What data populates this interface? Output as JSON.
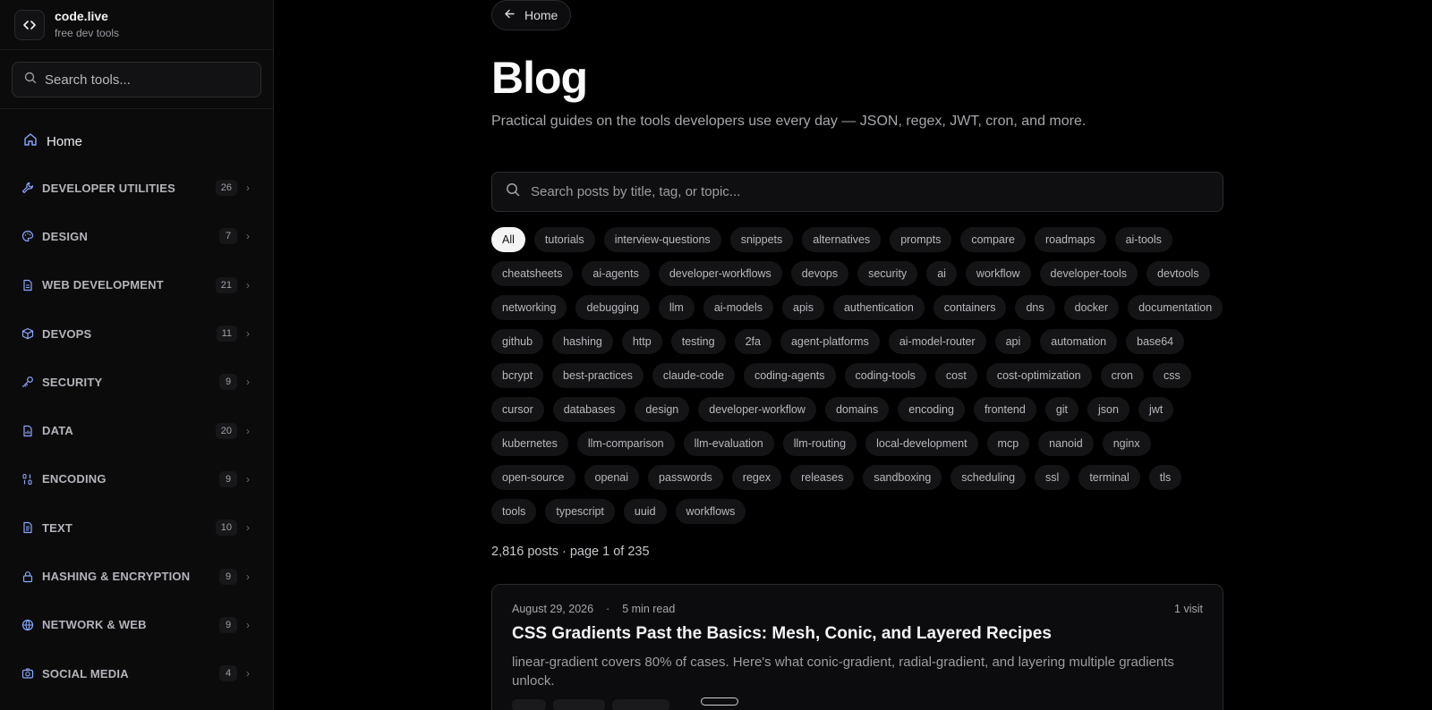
{
  "brand": {
    "name": "code.live",
    "subtitle": "free dev tools"
  },
  "sidebar": {
    "search_placeholder": "Search tools...",
    "home_label": "Home",
    "items": [
      {
        "label": "DEVELOPER UTILITIES",
        "count": "26",
        "icon": "wrench-icon"
      },
      {
        "label": "DESIGN",
        "count": "7",
        "icon": "palette-icon"
      },
      {
        "label": "WEB DEVELOPMENT",
        "count": "21",
        "icon": "file-text-icon"
      },
      {
        "label": "DEVOPS",
        "count": "11",
        "icon": "package-icon"
      },
      {
        "label": "SECURITY",
        "count": "9",
        "icon": "key-icon"
      },
      {
        "label": "DATA",
        "count": "20",
        "icon": "file-chart-icon"
      },
      {
        "label": "ENCODING",
        "count": "9",
        "icon": "binary-icon"
      },
      {
        "label": "TEXT",
        "count": "10",
        "icon": "file-lines-icon"
      },
      {
        "label": "HASHING & ENCRYPTION",
        "count": "9",
        "icon": "lock-icon"
      },
      {
        "label": "NETWORK & WEB",
        "count": "9",
        "icon": "globe-icon"
      },
      {
        "label": "SOCIAL MEDIA",
        "count": "4",
        "icon": "camera-icon"
      }
    ]
  },
  "main": {
    "back_label": "Home",
    "title": "Blog",
    "subtitle": "Practical guides on the tools developers use every day — JSON, regex, JWT, cron, and more.",
    "search_placeholder": "Search posts by title, tag, or topic...",
    "tags": [
      "All",
      "tutorials",
      "interview-questions",
      "snippets",
      "alternatives",
      "prompts",
      "compare",
      "roadmaps",
      "ai-tools",
      "cheatsheets",
      "ai-agents",
      "developer-workflows",
      "devops",
      "security",
      "ai",
      "workflow",
      "developer-tools",
      "devtools",
      "networking",
      "debugging",
      "llm",
      "ai-models",
      "apis",
      "authentication",
      "containers",
      "dns",
      "docker",
      "documentation",
      "github",
      "hashing",
      "http",
      "testing",
      "2fa",
      "agent-platforms",
      "ai-model-router",
      "api",
      "automation",
      "base64",
      "bcrypt",
      "best-practices",
      "claude-code",
      "coding-agents",
      "coding-tools",
      "cost",
      "cost-optimization",
      "cron",
      "css",
      "cursor",
      "databases",
      "design",
      "developer-workflow",
      "domains",
      "encoding",
      "frontend",
      "git",
      "json",
      "jwt",
      "kubernetes",
      "llm-comparison",
      "llm-evaluation",
      "llm-routing",
      "local-development",
      "mcp",
      "nanoid",
      "nginx",
      "open-source",
      "openai",
      "passwords",
      "regex",
      "releases",
      "sandboxing",
      "scheduling",
      "ssl",
      "terminal",
      "tls",
      "tools",
      "typescript",
      "uuid",
      "workflows"
    ],
    "active_tag": "All",
    "post_count": "2,816 posts · page 1 of 235",
    "post": {
      "date": "August 29, 2026",
      "dot": "·",
      "read_time": "5 min read",
      "visits": "1 visit",
      "title": "CSS Gradients Past the Basics: Mesh, Conic, and Layered Recipes",
      "description": "linear-gradient covers 80% of cases. Here's what conic-gradient, radial-gradient, and layering multiple gradients unlock."
    }
  },
  "colors": {
    "background": "#000000",
    "sidebar": "#0b0b0c",
    "accent_icon": "#8aa8ff"
  }
}
